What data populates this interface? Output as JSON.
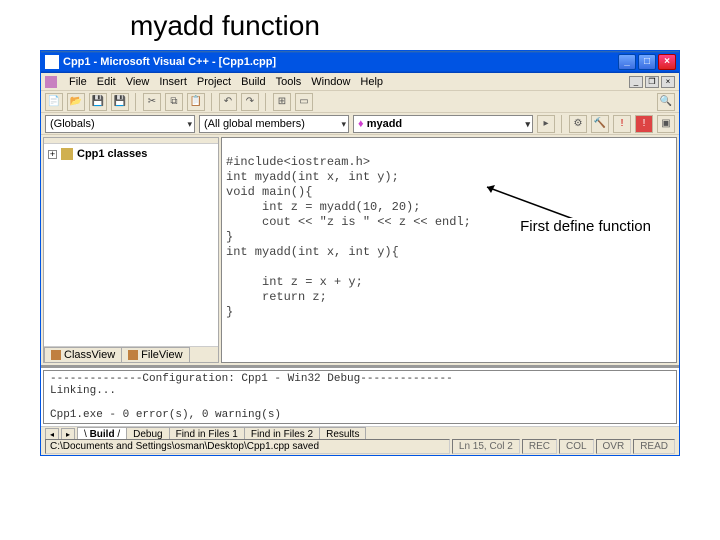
{
  "slide": {
    "title": "myadd function"
  },
  "window": {
    "title": "Cpp1 - Microsoft Visual C++ - [Cpp1.cpp]"
  },
  "menu": {
    "items": [
      "File",
      "Edit",
      "View",
      "Insert",
      "Project",
      "Build",
      "Tools",
      "Window",
      "Help"
    ]
  },
  "combos": {
    "scope": "(Globals)",
    "members": "(All global members)",
    "function": "myadd"
  },
  "tree": {
    "root": "Cpp1 classes"
  },
  "left_tabs": {
    "class_view": "ClassView",
    "file_view": "FileView"
  },
  "code": {
    "l1": "#include<iostream.h>",
    "l2": "int myadd(int x, int y);",
    "l3": "void main(){",
    "l4": "     int z = myadd(10, 20);",
    "l5": "     cout << \"z is \" << z << endl;",
    "l6": "}",
    "l7": "int myadd(int x, int y){",
    "l8": "",
    "l9": "     int z = x + y;",
    "l10": "     return z;",
    "l11": "}"
  },
  "annotation": {
    "text": "First define function"
  },
  "output": {
    "line1": "--------------Configuration: Cpp1 - Win32 Debug--------------",
    "line2": "Linking...",
    "line3": "",
    "line4": "Cpp1.exe - 0 error(s), 0 warning(s)"
  },
  "output_tabs": {
    "build": "Build",
    "debug": "Debug",
    "find1": "Find in Files 1",
    "find2": "Find in Files 2",
    "results": "Results"
  },
  "status": {
    "path": "C:\\Documents and Settings\\osman\\Desktop\\Cpp1.cpp saved",
    "pos": "Ln 15, Col 2",
    "ind1": "REC",
    "ind2": "COL",
    "ind3": "OVR",
    "ind4": "READ"
  }
}
